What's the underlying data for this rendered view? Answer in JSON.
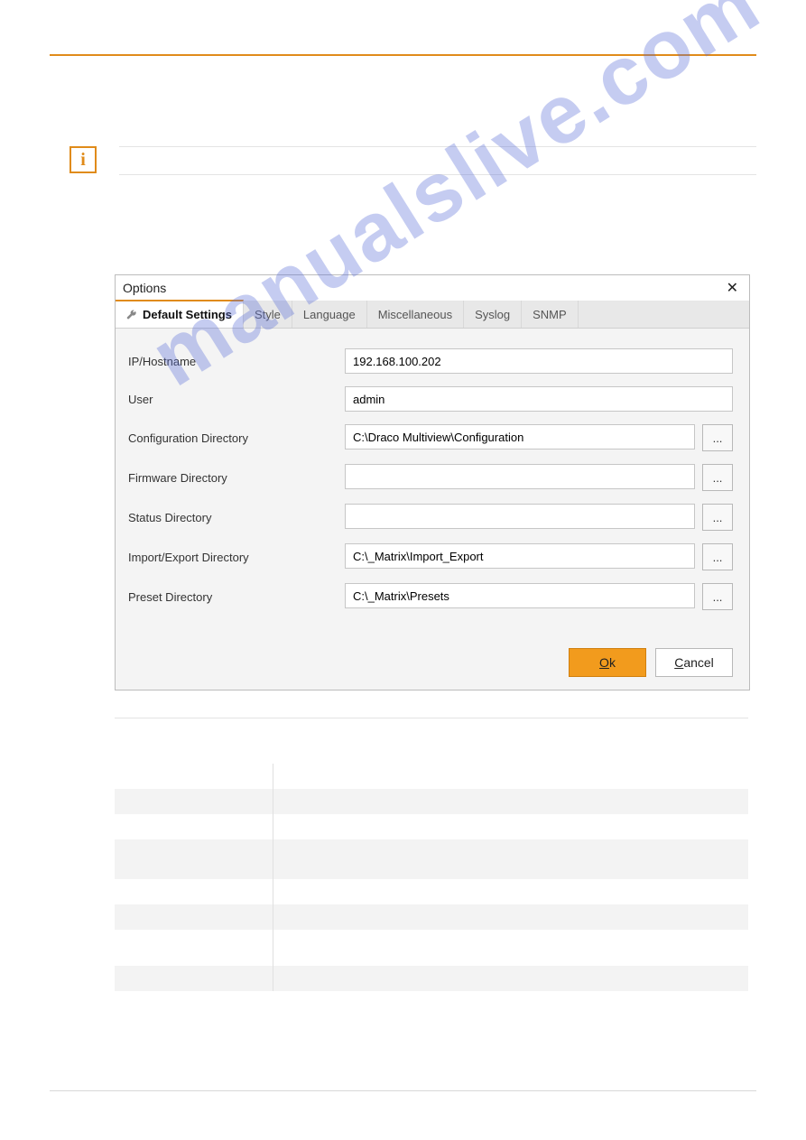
{
  "watermark": "manualslive.com",
  "dialog": {
    "title": "Options",
    "close": "✕",
    "tabs": {
      "default": "Default Settings",
      "style": "Style",
      "language": "Language",
      "misc": "Miscellaneous",
      "syslog": "Syslog",
      "snmp": "SNMP"
    },
    "labels": {
      "ip": "IP/Hostname",
      "user": "User",
      "confdir": "Configuration Directory",
      "fwdir": "Firmware Directory",
      "statusdir": "Status Directory",
      "iedir": "Import/Export Directory",
      "presetdir": "Preset Directory"
    },
    "values": {
      "ip": "192.168.100.202",
      "user": "admin",
      "confdir": "C:\\Draco Multiview\\Configuration",
      "fwdir": "",
      "statusdir": "",
      "iedir": "C:\\_Matrix\\Import_Export",
      "presetdir": "C:\\_Matrix\\Presets"
    },
    "browse": "...",
    "ok_prefix": "O",
    "ok_rest": "k",
    "cancel_prefix": "C",
    "cancel_rest": "ancel"
  }
}
